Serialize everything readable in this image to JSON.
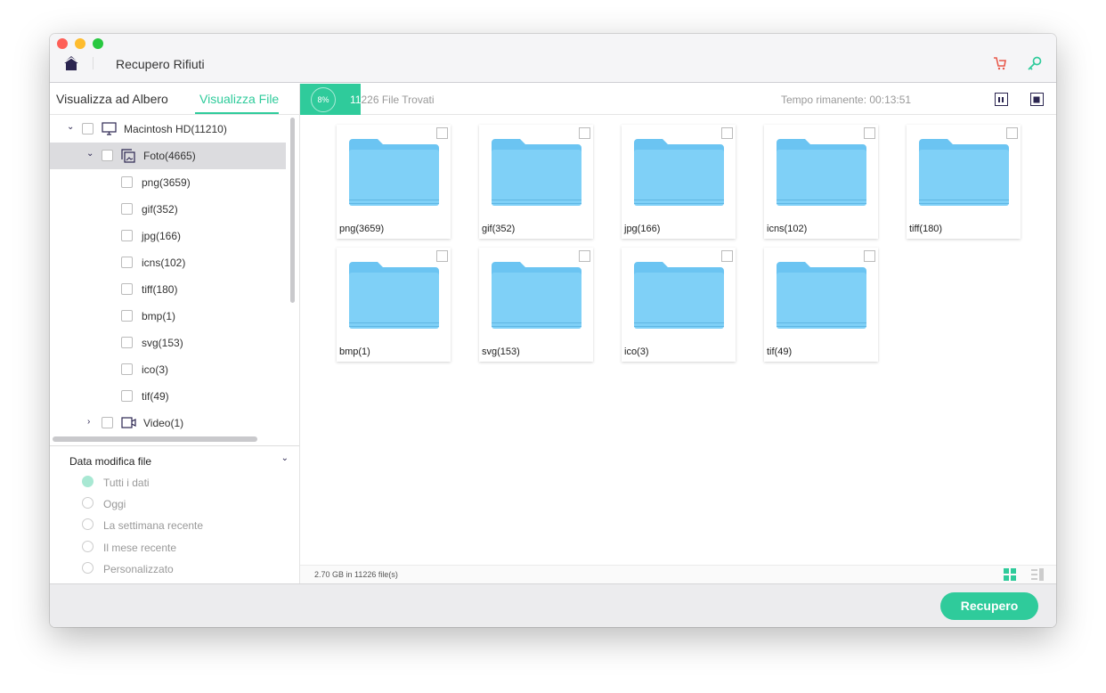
{
  "header": {
    "title": "Recupero Rifiuti",
    "colors": {
      "cart": "#e8584a",
      "key": "#2fcb9b",
      "accent": "#2fcb9b"
    }
  },
  "tabs": [
    {
      "label": "Visualizza ad Albero"
    },
    {
      "label": "Visualizza File"
    }
  ],
  "scan": {
    "percent_label": "8%",
    "progress": 8,
    "found_prefix": "11",
    "found_rest": "226 File Trovati",
    "remaining": "Tempo rimanente: 00:13:51"
  },
  "tree": [
    {
      "label": "Macintosh HD(11210)"
    },
    {
      "label": "Foto(4665)"
    },
    {
      "label": "png(3659)"
    },
    {
      "label": "gif(352)"
    },
    {
      "label": "jpg(166)"
    },
    {
      "label": "icns(102)"
    },
    {
      "label": "tiff(180)"
    },
    {
      "label": "bmp(1)"
    },
    {
      "label": "svg(153)"
    },
    {
      "label": "ico(3)"
    },
    {
      "label": "tif(49)"
    },
    {
      "label": "Video(1)"
    }
  ],
  "filter": {
    "title": "Data modifica file",
    "options": [
      "Tutti i dati",
      "Oggi",
      "La settimana recente",
      "Il mese recente",
      "Personalizzato"
    ],
    "selected": 0
  },
  "files": [
    "png(3659)",
    "gif(352)",
    "jpg(166)",
    "icns(102)",
    "tiff(180)",
    "bmp(1)",
    "svg(153)",
    "ico(3)",
    "tif(49)"
  ],
  "status": "2.70 GB in 11226 file(s)",
  "footer": {
    "recover_label": "Recupero"
  }
}
